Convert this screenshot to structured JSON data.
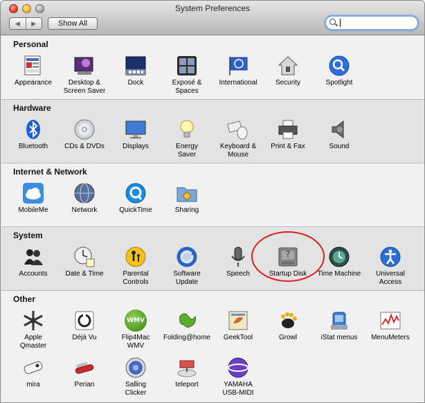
{
  "window": {
    "title": "System Preferences"
  },
  "toolbar": {
    "back": "◀",
    "forward": "▶",
    "show_all": "Show All",
    "search_placeholder": ""
  },
  "sections": {
    "personal": {
      "title": "Personal"
    },
    "hardware": {
      "title": "Hardware"
    },
    "internet": {
      "title": "Internet & Network"
    },
    "system": {
      "title": "System"
    },
    "other": {
      "title": "Other"
    }
  },
  "panes": {
    "appearance": "Appearance",
    "desktop": "Desktop &\nScreen Saver",
    "dock": "Dock",
    "expose": "Exposé &\nSpaces",
    "international": "International",
    "security": "Security",
    "spotlight": "Spotlight",
    "bluetooth": "Bluetooth",
    "cds": "CDs & DVDs",
    "displays": "Displays",
    "energy": "Energy\nSaver",
    "keyboard": "Keyboard &\nMouse",
    "print": "Print & Fax",
    "sound": "Sound",
    "mobileme": "MobileMe",
    "network": "Network",
    "quicktime": "QuickTime",
    "sharing": "Sharing",
    "accounts": "Accounts",
    "datetime": "Date & Time",
    "parental": "Parental\nControls",
    "software": "Software\nUpdate",
    "speech": "Speech",
    "startup": "Startup Disk",
    "timemachine": "Time Machine",
    "universal": "Universal\nAccess",
    "applemaster": "Apple\nQmaster",
    "dejavu": "Déjà Vu",
    "flip4mac": "Flip4Mac\nWMV",
    "folding": "Folding@home",
    "geektool": "GeekTool",
    "growl": "Growl",
    "istat": "iStat menus",
    "menumeters": "MenuMeters",
    "mira": "mira",
    "perian": "Perian",
    "salling": "Salling\nClicker",
    "teleport": "teleport",
    "yamaha": "YAMAHA\nUSB-MIDI"
  },
  "icon_text": {
    "wmv": "WMV",
    "disk": "?",
    "q": "Q"
  },
  "colors": {
    "annotation": "#d71e1e",
    "search_focus": "#7fa6dc"
  }
}
